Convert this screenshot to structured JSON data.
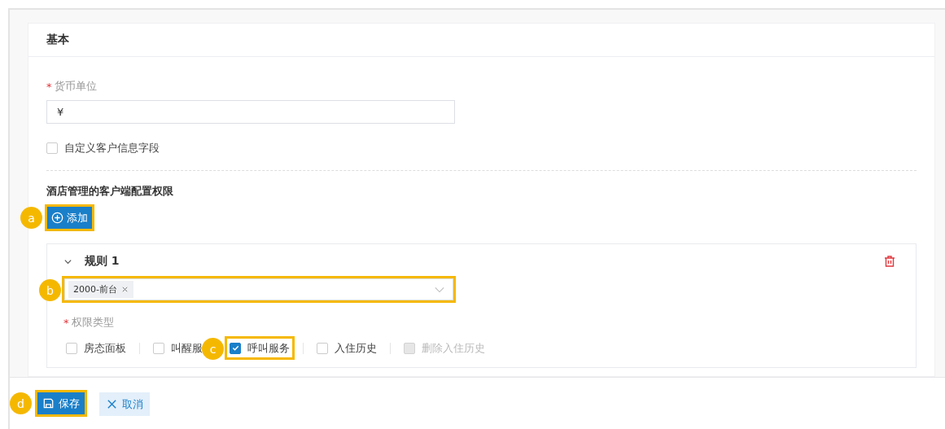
{
  "section": {
    "title": "基本"
  },
  "currency": {
    "required_mark": "*",
    "label": "货币单位",
    "value": "¥"
  },
  "custom_fields": {
    "label": "自定义客户信息字段",
    "checked": false
  },
  "permissions": {
    "title": "酒店管理的客户端配置权限",
    "add_button": {
      "label": "添加",
      "callout": "a"
    },
    "rules": [
      {
        "title": "规则 1",
        "expanded": true,
        "select": {
          "tags": [
            "2000-前台"
          ],
          "callout": "b"
        },
        "type_required_mark": "*",
        "type_label": "权限类型",
        "options": [
          {
            "label": "房态面板",
            "checked": false,
            "disabled": false
          },
          {
            "label": "叫醒服",
            "checked": false,
            "disabled": false
          },
          {
            "label": "呼叫服务",
            "checked": true,
            "disabled": false,
            "callout": "c"
          },
          {
            "label": "入住历史",
            "checked": false,
            "disabled": false
          },
          {
            "label": "删除入住历史",
            "checked": false,
            "disabled": true
          }
        ]
      }
    ]
  },
  "footer": {
    "buttons": [
      {
        "kind": "save",
        "label": "保存",
        "callout": "d"
      },
      {
        "kind": "cancel",
        "label": "取消"
      }
    ]
  }
}
